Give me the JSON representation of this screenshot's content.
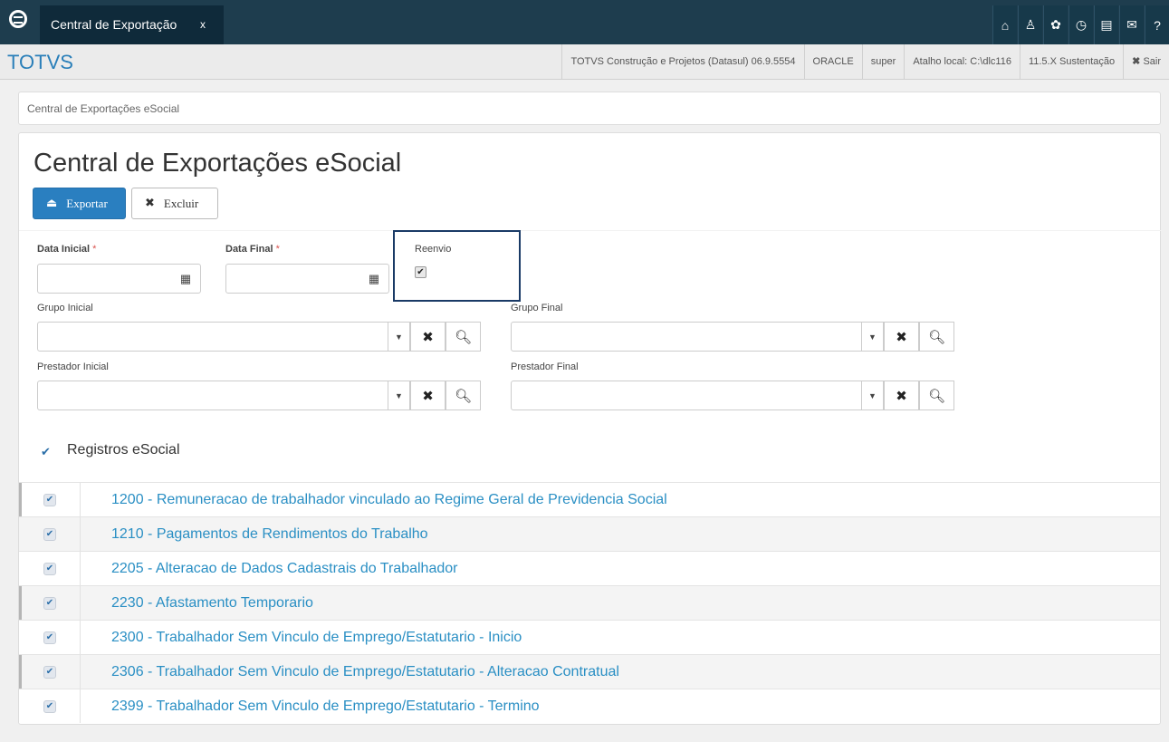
{
  "topbar": {
    "tab_label": "Central de Exportação",
    "tab_close": "x",
    "icons": [
      "home-icon",
      "sitemap-icon",
      "gear-icon",
      "clock-icon",
      "document-icon",
      "mail-icon",
      "help-icon"
    ]
  },
  "header": {
    "brand": "TOTVS",
    "company": "TOTVS Construção e Projetos (Datasul) 06.9.5554",
    "database": "ORACLE",
    "user": "super",
    "shortcut": "Atalho local: C:\\dlc116",
    "version": "11.5.X Sustentação",
    "logout": "Sair"
  },
  "breadcrumb": "Central de Exportações eSocial",
  "page": {
    "title": "Central de Exportações eSocial",
    "export_button": "Exportar",
    "delete_button": "Excluir"
  },
  "form": {
    "data_inicial_label": "Data Inicial",
    "data_final_label": "Data Final",
    "required_marker": "*",
    "data_inicial_value": "",
    "data_final_value": "",
    "reenvio_label": "Reenvio",
    "reenvio_checked": true,
    "grupo_inicial_label": "Grupo Inicial",
    "grupo_final_label": "Grupo Final",
    "prestador_inicial_label": "Prestador Inicial",
    "prestador_final_label": "Prestador Final"
  },
  "registros": {
    "label": "Registros eSocial",
    "checked": true,
    "items": [
      {
        "label": "1200 - Remuneracao de trabalhador vinculado ao Regime Geral de Previdencia Social",
        "checked": true
      },
      {
        "label": "1210 - Pagamentos de Rendimentos do Trabalho",
        "checked": true
      },
      {
        "label": "2205 - Alteracao de Dados Cadastrais do Trabalhador",
        "checked": true
      },
      {
        "label": "2230 - Afastamento Temporario",
        "checked": true
      },
      {
        "label": "2300 - Trabalhador Sem Vinculo de Emprego/Estatutario - Inicio",
        "checked": true
      },
      {
        "label": "2306 - Trabalhador Sem Vinculo de Emprego/Estatutario - Alteracao Contratual",
        "checked": true
      },
      {
        "label": "2399 - Trabalhador Sem Vinculo de Emprego/Estatutario - Termino",
        "checked": true
      }
    ]
  },
  "colors": {
    "topbar": "#1e3d4e",
    "brand": "#2a7fb9",
    "primary_button": "#2a7fc0",
    "link_text": "#2a8fc4",
    "required": "#d9534f",
    "highlight_box": "#1a3a66"
  }
}
